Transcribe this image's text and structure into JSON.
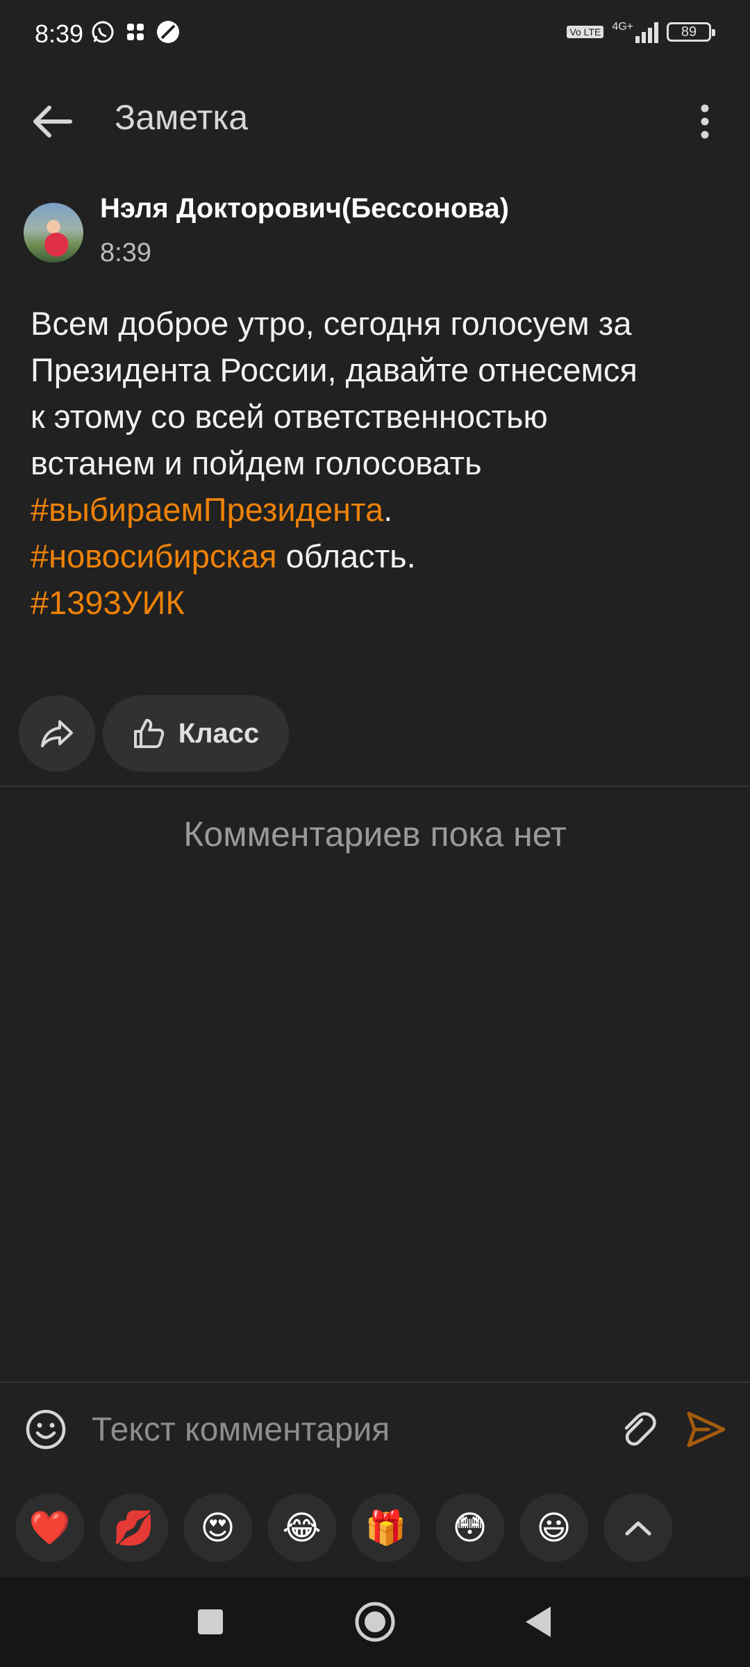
{
  "status_bar": {
    "time": "8:39",
    "network": "4G+",
    "volte": "Vo LTE",
    "battery": "89",
    "icons": [
      "whatsapp-icon",
      "grid-icon",
      "compass-icon",
      "signal-icon"
    ]
  },
  "header": {
    "title": "Заметка",
    "back_icon": "arrow-left-icon",
    "menu_icon": "more-vert-icon"
  },
  "post": {
    "author": "Нэля Докторович(Бессонова)",
    "time": "8:39",
    "text_line1": "Всем доброе утро, сегодня голосуем за",
    "text_line2": "Президента России, давайте отнесемся",
    "text_line3": "к этому со всей ответственностью",
    "text_line4": "встанем и пойдем голосовать",
    "tag1": "#выбираемПрезидента",
    "tag1_suffix": ".",
    "tag2": "#новосибирская",
    "tag2_suffix": " область.",
    "tag3": "#1393УИК",
    "tag_color": "#ee8208"
  },
  "actions": {
    "share_icon": "share-icon",
    "like_icon": "thumbs-up-icon",
    "like_label": "Класс"
  },
  "comments": {
    "empty_text": "Комментариев пока нет"
  },
  "comment_input": {
    "placeholder": "Текст комментария",
    "value": "",
    "send_color": "#ee8208"
  },
  "reactions": [
    {
      "emoji": "❤️",
      "name": "heart"
    },
    {
      "emoji": "💋",
      "name": "kiss"
    },
    {
      "emoji": "😍",
      "name": "heart-eyes"
    },
    {
      "emoji": "😂",
      "name": "joy"
    },
    {
      "emoji": "🎁",
      "name": "gift"
    },
    {
      "emoji": "😳",
      "name": "flushed"
    },
    {
      "emoji": "😃",
      "name": "smiley"
    }
  ]
}
